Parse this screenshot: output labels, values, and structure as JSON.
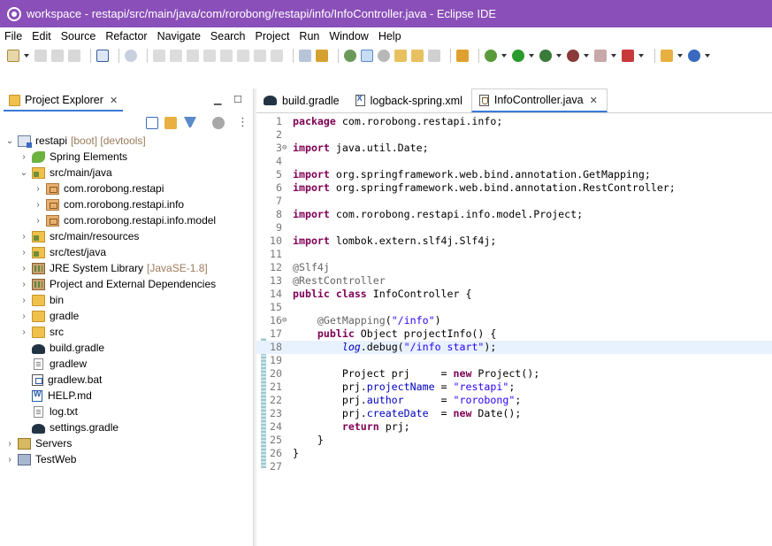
{
  "window": {
    "title": "workspace - restapi/src/main/java/com/rorobong/restapi/info/InfoController.java - Eclipse IDE"
  },
  "menu": [
    "File",
    "Edit",
    "Source",
    "Refactor",
    "Navigate",
    "Search",
    "Project",
    "Run",
    "Window",
    "Help"
  ],
  "explorer": {
    "tab_label": "Project Explorer",
    "tree": [
      {
        "label": "restapi",
        "decoration": "[boot] [devtools]"
      },
      {
        "label": "Spring Elements"
      },
      {
        "label": "src/main/java"
      },
      {
        "label": "com.rorobong.restapi"
      },
      {
        "label": "com.rorobong.restapi.info"
      },
      {
        "label": "com.rorobong.restapi.info.model"
      },
      {
        "label": "src/main/resources"
      },
      {
        "label": "src/test/java"
      },
      {
        "label": "JRE System Library",
        "decoration": "[JavaSE-1.8]"
      },
      {
        "label": "Project and External Dependencies"
      },
      {
        "label": "bin"
      },
      {
        "label": "gradle"
      },
      {
        "label": "src"
      },
      {
        "label": "build.gradle"
      },
      {
        "label": "gradlew"
      },
      {
        "label": "gradlew.bat"
      },
      {
        "label": "HELP.md"
      },
      {
        "label": "log.txt"
      },
      {
        "label": "settings.gradle"
      },
      {
        "label": "Servers"
      },
      {
        "label": "TestWeb"
      }
    ]
  },
  "editor": {
    "tabs": [
      {
        "label": "build.gradle"
      },
      {
        "label": "logback-spring.xml"
      },
      {
        "label": "InfoController.java",
        "active": true
      }
    ],
    "line_numbers": [
      "1",
      "2",
      "3",
      "4",
      "5",
      "6",
      "7",
      "8",
      "9",
      "10",
      "11",
      "12",
      "13",
      "14",
      "15",
      "16",
      "17",
      "18",
      "19",
      "20",
      "21",
      "22",
      "23",
      "24",
      "25",
      "26",
      "27"
    ],
    "code": {
      "l1_kw": "package",
      "l1_rest": " com.rorobong.restapi.info;",
      "l3_kw": "import",
      "l3_rest": " java.util.Date;",
      "l5_kw": "import",
      "l5_rest": " org.springframework.web.bind.annotation.GetMapping;",
      "l6_kw": "import",
      "l6_rest": " org.springframework.web.bind.annotation.RestController;",
      "l8_kw": "import",
      "l8_rest": " com.rorobong.restapi.info.model.Project;",
      "l10_kw": "import",
      "l10_rest": " lombok.extern.slf4j.Slf4j;",
      "l12_ann": "@Slf4j",
      "l13_ann": "@RestController",
      "l14_kw1": "public",
      "l14_kw2": "class",
      "l14_rest": " InfoController {",
      "l16_ann": "@GetMapping",
      "l16_p1": "(",
      "l16_str": "\"/info\"",
      "l16_p2": ")",
      "l17_kw": "public",
      "l17_rest": " Object projectInfo() {",
      "l18_log": "log",
      "l18_mid": ".debug(",
      "l18_str": "\"/info start\"",
      "l18_end": ");",
      "l20_pre": "Project prj     = ",
      "l20_kw": "new",
      "l20_rest": " Project();",
      "l21_obj": "prj.",
      "l21_fld": "projectName",
      "l21_eq": " = ",
      "l21_str": "\"restapi\"",
      "l21_end": ";",
      "l22_obj": "prj.",
      "l22_fld": "author",
      "l22_eq": "      = ",
      "l22_str": "\"rorobong\"",
      "l22_end": ";",
      "l23_obj": "prj.",
      "l23_fld": "createDate",
      "l23_eq": "  = ",
      "l23_kw": "new",
      "l23_rest": " Date();",
      "l24_kw": "return",
      "l24_rest": " prj;",
      "l25_txt": "}",
      "l26_txt": "}"
    }
  }
}
